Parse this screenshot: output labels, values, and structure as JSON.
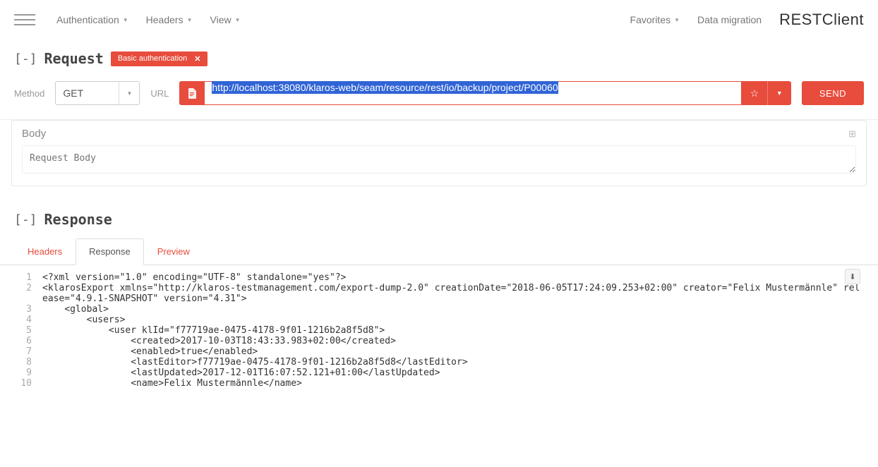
{
  "topnav": {
    "items": [
      "Authentication",
      "Headers",
      "View"
    ],
    "right": [
      "Favorites",
      "Data migration"
    ],
    "brand": "RESTClient"
  },
  "request": {
    "toggle": "[-]",
    "title": "Request",
    "badge": "Basic authentication",
    "method_label": "Method",
    "method_value": "GET",
    "url_label": "URL",
    "url_value": "http://localhost:38080/klaros-web/seam/resource/rest/io/backup/project/P00060",
    "send_label": "SEND"
  },
  "body": {
    "title": "Body",
    "placeholder": "Request Body"
  },
  "response": {
    "toggle": "[-]",
    "title": "Response",
    "tabs": [
      "Headers",
      "Response",
      "Preview"
    ],
    "active_tab": 1,
    "lines": [
      "<?xml version=\"1.0\" encoding=\"UTF-8\" standalone=\"yes\"?>",
      "<klarosExport xmlns=\"http://klaros-testmanagement.com/export-dump-2.0\" creationDate=\"2018-06-05T17:24:09.253+02:00\" creator=\"Felix Mustermännle\" release=\"4.9.1-SNAPSHOT\" version=\"4.31\">",
      "    <global>",
      "        <users>",
      "            <user klId=\"f77719ae-0475-4178-9f01-1216b2a8f5d8\">",
      "                <created>2017-10-03T18:43:33.983+02:00</created>",
      "                <enabled>true</enabled>",
      "                <lastEditor>f77719ae-0475-4178-9f01-1216b2a8f5d8</lastEditor>",
      "                <lastUpdated>2017-12-01T16:07:52.121+01:00</lastUpdated>",
      "                <name>Felix Mustermännle</name>"
    ]
  }
}
